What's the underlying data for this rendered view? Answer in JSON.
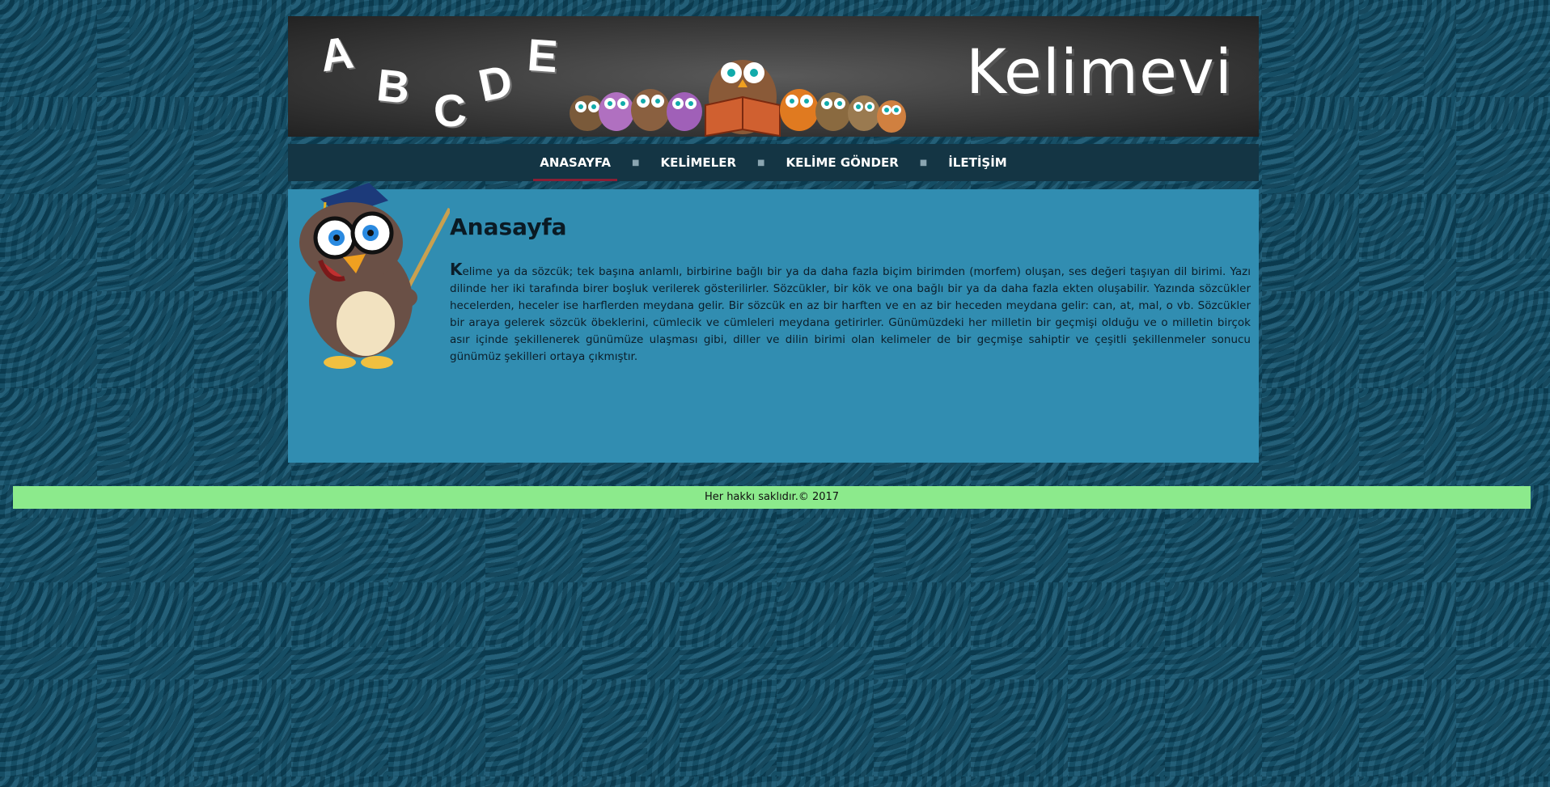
{
  "header": {
    "letters": [
      "A",
      "B",
      "C",
      "D",
      "E"
    ],
    "brand": "Kelimevi"
  },
  "nav": {
    "items": [
      {
        "label": "ANASAYFA",
        "active": true
      },
      {
        "label": "KELİMELER",
        "active": false
      },
      {
        "label": "KELİME GÖNDER",
        "active": false
      },
      {
        "label": "İLETİŞİM",
        "active": false
      }
    ]
  },
  "main": {
    "title": "Anasayfa",
    "first_letter": "K",
    "body": "elime ya da sözcük; tek başına anlamlı, birbirine bağlı bir ya da daha fazla biçim birimden (morfem) oluşan, ses değeri taşıyan dil birimi. Yazı dilinde her iki tarafında birer boşluk verilerek gösterilirler. Sözcükler, bir kök ve ona bağlı bir ya da daha fazla ekten oluşabilir. Yazında sözcükler hecelerden, heceler ise harflerden meydana gelir. Bir sözcük en az bir harften ve en az bir heceden meydana gelir: can, at, mal, o vb. Sözcükler bir araya gelerek sözcük öbeklerini, cümlecik ve cümleleri meydana getirirler. Günümüzdeki her milletin bir geçmişi olduğu ve o milletin birçok asır içinde şekillenerek günümüze ulaşması gibi, diller ve dilin birimi olan kelimeler de bir geçmişe sahiptir ve çeşitli şekillenmeler sonucu günümüz şekilleri ortaya çıkmıştır."
  },
  "footer": {
    "text": "Her hakkı saklıdır.© 2017"
  },
  "colors": {
    "nav_bg": "#143544",
    "content_bg": "#318db1",
    "footer_bg": "#8cea8c",
    "active_underline": "#8a1f35"
  }
}
